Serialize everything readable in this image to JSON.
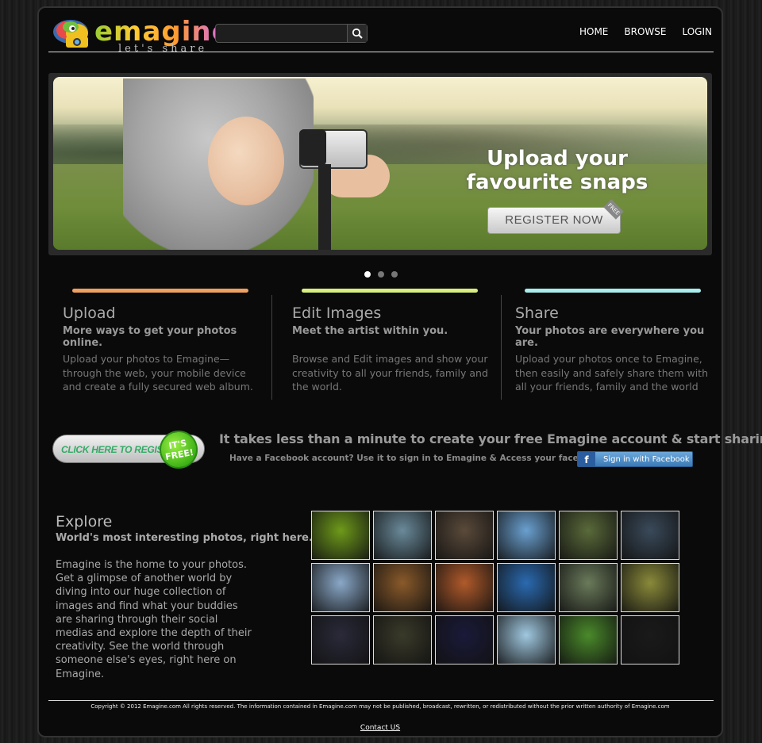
{
  "header": {
    "logo_text": "emagine",
    "logo_tagline": "let's share",
    "search": {
      "placeholder": "",
      "value": ""
    },
    "nav": [
      {
        "label": "HOME"
      },
      {
        "label": "BROWSE"
      },
      {
        "label": "LOGIN"
      }
    ]
  },
  "banner": {
    "headline_line1": "Upload your",
    "headline_line2": "favourite snaps",
    "register_label": "REGISTER NOW",
    "free_tag": "FREE",
    "slides": 3,
    "active_slide": 1
  },
  "features": [
    {
      "title": "Upload",
      "subtitle": "More ways to get your photos online.",
      "body": "Upload your photos to Emagine—through the web, your mobile device and create a fully secured web album.",
      "color": "#f0a060"
    },
    {
      "title": "Edit Images",
      "subtitle": "Meet the artist within you.",
      "body": "Browse and Edit images and show your creativity to all your friends, family and the world.",
      "color": "#d8ee80"
    },
    {
      "title": "Share",
      "subtitle": "Your photos are everywhere you are.",
      "body": "Upload your photos once to Emagine, then easily and safely share them with all your friends, family and the world",
      "color": "#a8eeee"
    }
  ],
  "cta": {
    "button_label": "CLICK HERE TO REGISTER",
    "badge_line1": "IT'S",
    "badge_line2": "FREE!",
    "headline": "It takes less than a minute to create your free Emagine account & start sharing!",
    "sub": "Have a Facebook account? Use it to sign in to Emagine & Access your facebook images!",
    "facebook_icon": "f",
    "facebook_label": "Sign in with Facebook"
  },
  "explore": {
    "title": "Explore",
    "subtitle": "World's most interesting photos, right here.",
    "body": "Emagine is the home to your photos. Get a glimpse of another world by diving into our huge collection of images and find what your buddies are sharing through their social medias and explore the depth of their creativity. See the world through someone else's eyes, right here on Emagine."
  },
  "thumbnails": [
    "#6e9a1a",
    "#6a8a9a",
    "#5a4a3a",
    "#6aa0d0",
    "#5a6a3a",
    "#3a4a5a",
    "#8aa8c8",
    "#8a5a2a",
    "#b05a2a",
    "#2a6ab0",
    "#6a7a5a",
    "#8a8a3a",
    "#2a2a3a",
    "#3a3a2a",
    "#1a1a3a",
    "#a0c8e0",
    "#4a8a2a",
    "#1a1a1a"
  ],
  "footer": {
    "copyright": "Copyright © 2012 Emagine.com All rights reserved. The information contained in Emagine.com may not be published, broadcast, rewritten, or redistributed without the prior written authority of Emagine.com",
    "contact_label": "Contact US"
  }
}
